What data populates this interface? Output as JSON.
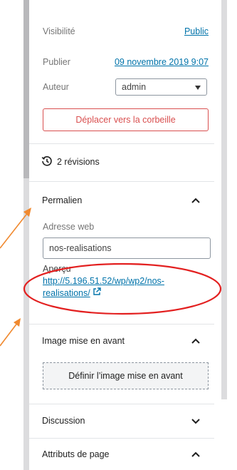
{
  "status_panel": {
    "visibility_label": "Visibilité",
    "visibility_value": "Public",
    "publish_label": "Publier",
    "publish_value": "09 novembre 2019 9:07",
    "author_label": "Auteur",
    "author_value": "admin",
    "trash_label": "Déplacer vers la corbeille"
  },
  "revisions": {
    "label": "2 révisions"
  },
  "permalink": {
    "title": "Permalien",
    "url_label": "Adresse web",
    "url_value": "nos-realisations",
    "preview_label": "Aperçu",
    "preview_link": "http://5.196.51.52/wp/wp2/nos-realisations/"
  },
  "featured_image": {
    "title": "Image mise en avant",
    "button_label": "Définir l’image mise en avant"
  },
  "discussion": {
    "title": "Discussion"
  },
  "page_attributes": {
    "title": "Attributs de page"
  },
  "colors": {
    "link": "#0073aa",
    "danger": "#d94f4f",
    "annotation_arrow": "#f0892f",
    "annotation_circle": "#e32020"
  }
}
